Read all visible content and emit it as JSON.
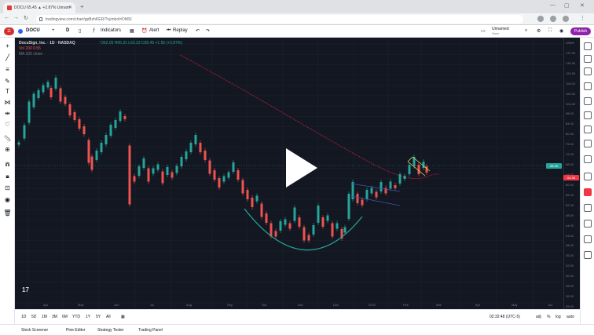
{
  "browser": {
    "tab_title": "DOCU 65.45 ▲ +2.87% Unnam",
    "url": "tradingview.com/chart/gpBzhKER/?symbol=DMSI"
  },
  "toolbar": {
    "symbol": "DOCU",
    "interval": "D",
    "indicators": "Indicators",
    "alert": "Alert",
    "replay": "Replay",
    "layout_name": "Unnamed",
    "layout_sub": "Save",
    "publish": "Publish"
  },
  "legend": {
    "title": "DocuSign, Inc. · 1D · NASDAQ",
    "ohlc": "O62.05 H65.31 L62.33 C65.45 +1.55 (+2.87%)",
    "indicator1": "Vol 200  0.55",
    "indicator2": "MA 200 close"
  },
  "price_axis": {
    "labels": [
      "USD▾",
      "137.00",
      "130.00",
      "124.00",
      "118.00",
      "110.00",
      "104.00",
      "98.00",
      "84.00",
      "80.00",
      "75.00",
      "72.00",
      "68.00",
      "64.00",
      "60.00",
      "56.00",
      "52.00",
      "48.00",
      "44.00",
      "41.00",
      "38.00",
      "35.00",
      "32.00",
      "30.00",
      "28.00",
      "26.00",
      "25.00"
    ],
    "tag_green": "65.45",
    "tag_red": "64.36"
  },
  "date_axis": {
    "labels": [
      "Apr",
      "May",
      "Jun",
      "Jul",
      "Aug",
      "Sep",
      "Oct",
      "Nov",
      "Dec",
      "2023",
      "Feb",
      "Mar",
      "Apr",
      "May",
      "Jun"
    ]
  },
  "timeframes": [
    "1D",
    "5D",
    "1M",
    "3M",
    "6M",
    "YTD",
    "1Y",
    "5Y",
    "All"
  ],
  "bottom_right": {
    "time": "02:32:48 (UTC-5)",
    "adj": "adj",
    "pct": "%",
    "log": "log",
    "auto": "auto"
  },
  "panels": [
    "Stock Screener",
    "Pine Editor",
    "Strategy Tester",
    "Trading Panel"
  ],
  "colors": {
    "up": "#26a69a",
    "down": "#ef5350",
    "ma": "#b71c3c",
    "pattern": "#26a69a",
    "channel": "#3f51b5",
    "flag": "#f0d060"
  },
  "icons": {
    "left_toolbar": [
      "crosshair-icon",
      "trendline-icon",
      "fib-icon",
      "brush-icon",
      "text-icon",
      "pattern-icon",
      "measure-icon",
      "heart-icon",
      "ruler-icon",
      "zoom-icon",
      "magnet-icon",
      "lock-icon",
      "eye-icon",
      "trash-icon"
    ]
  }
}
